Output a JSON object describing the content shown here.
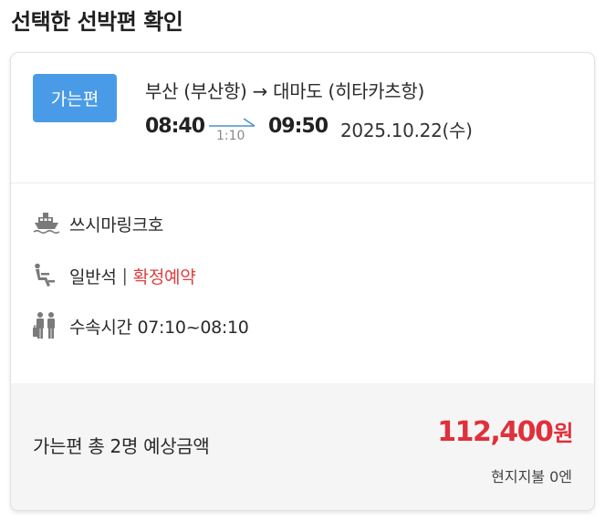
{
  "page_title": "선택한 선박편 확인",
  "route": {
    "badge": "가는편",
    "route_text": "부산 (부산항) → 대마도 (히타카츠항)",
    "departure_time": "08:40",
    "duration": "1:10",
    "arrival_time": "09:50",
    "date": "2025.10.22(수)"
  },
  "details": {
    "ship_icon": "ship-icon",
    "ship_name": "쓰시마링크호",
    "seat_icon": "seat-icon",
    "seat_class": "일반석",
    "separator": "|",
    "reservation_status": "확정예약",
    "checkin_icon": "passenger-luggage-icon",
    "checkin_time": "수속시간 07:10~08:10"
  },
  "summary": {
    "total_label": "가는편 총 2명 예상금액",
    "total_amount": "112,400",
    "currency": "원",
    "onsite_fee": "현지지불 0엔"
  },
  "colors": {
    "badge_bg": "#4a9be7",
    "accent_red": "#e0303b",
    "arrow_blue": "#4a90c8"
  }
}
